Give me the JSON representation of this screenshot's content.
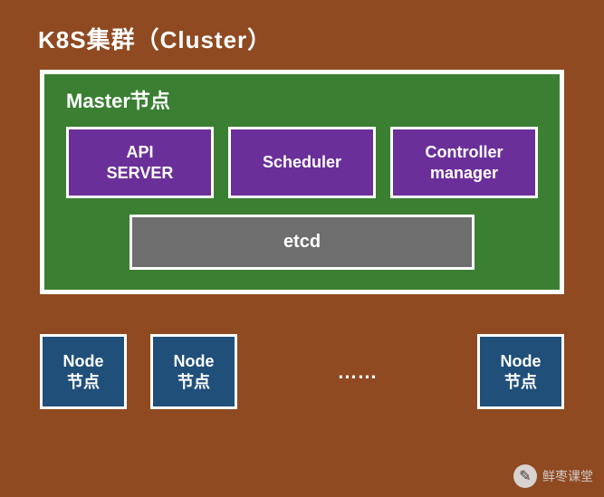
{
  "title": "K8S集群（Cluster）",
  "master": {
    "title": "Master节点",
    "components": [
      {
        "label": "API\nSERVER"
      },
      {
        "label": "Scheduler"
      },
      {
        "label": "Controller\nmanager"
      }
    ],
    "etcd": "etcd"
  },
  "nodes": {
    "label": "Node\n节点",
    "ellipsis": "……"
  },
  "watermark": {
    "icon": "✎",
    "text": "鲜枣课堂"
  }
}
